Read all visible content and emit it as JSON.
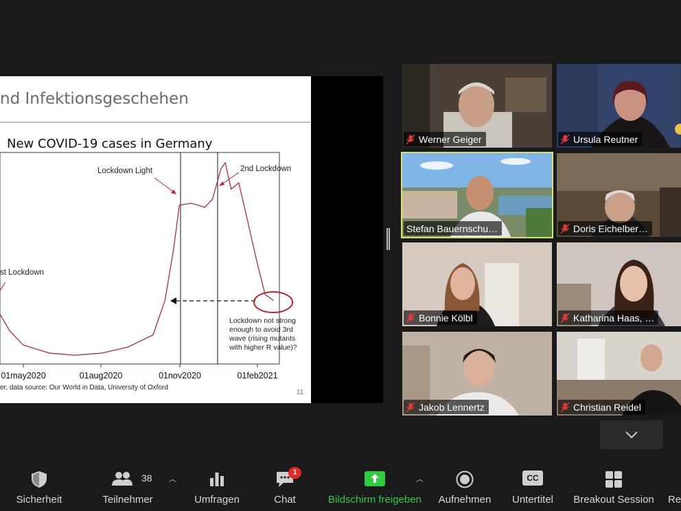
{
  "slide": {
    "title": "nd Infektionsgeschehen",
    "chart_title": "New COVID-19 cases in Germany",
    "annotations": {
      "lockdown_light": "Lockdown Light",
      "second_lockdown": "2nd Lockdown",
      "first_lockdown": "st Lockdown",
      "note_lines": [
        "Lockdown not strong",
        "enough to avoid 3rd",
        "wave (rising mutants",
        "with higher R value)?"
      ]
    },
    "source": "er, data source: Our World in Data, University of Oxford",
    "page_number": "11"
  },
  "chart_data": {
    "type": "line",
    "title": "New COVID-19 cases in Germany",
    "xlabel": "",
    "ylabel": "",
    "x_ticks": [
      "01may2020",
      "01aug2020",
      "01nov2020",
      "01feb2021"
    ],
    "series": [
      {
        "x": [
          "2020-03-15",
          "2020-04-01",
          "2020-04-15",
          "2020-05-01",
          "2020-06-01",
          "2020-07-01",
          "2020-08-01",
          "2020-09-01",
          "2020-10-01",
          "2020-10-15",
          "2020-10-25",
          "2020-11-01",
          "2020-11-15",
          "2020-12-01",
          "2020-12-10",
          "2020-12-20",
          "2020-12-25",
          "2021-01-01",
          "2021-01-10",
          "2021-01-20",
          "2021-02-01",
          "2021-02-10",
          "2021-02-20"
        ],
        "y_relative": [
          0.4,
          0.25,
          0.15,
          0.08,
          0.04,
          0.03,
          0.04,
          0.07,
          0.13,
          0.3,
          0.55,
          0.77,
          0.78,
          0.76,
          0.8,
          0.95,
          0.98,
          0.85,
          0.88,
          0.7,
          0.48,
          0.33,
          0.3
        ]
      }
    ]
  },
  "participants": [
    {
      "name": "Werner Geiger",
      "muted": true
    },
    {
      "name": "Ursula Reutner",
      "muted": true
    },
    {
      "name": "Stefan Bauernschu…",
      "muted": false,
      "active": true
    },
    {
      "name": "Doris Eichelber…",
      "muted": true
    },
    {
      "name": "Bonnie Kölbl",
      "muted": true
    },
    {
      "name": "Katharina Haas, …",
      "muted": true
    },
    {
      "name": "Jakob Lennertz",
      "muted": true
    },
    {
      "name": "Christian Reidel",
      "muted": true
    }
  ],
  "toolbar": {
    "security": "Sicherheit",
    "participants": "Teilnehmer",
    "participants_count": "38",
    "polls": "Umfragen",
    "chat": "Chat",
    "chat_badge": "1",
    "share": "Bildschirm freigeben",
    "record": "Aufnehmen",
    "subtitles": "Untertitel",
    "cc_glyph": "CC",
    "breakout": "Breakout Session",
    "reactions": "Re"
  },
  "colors": {
    "background": "#1a1a1a",
    "share_green": "#2ecc40",
    "active_speaker": "#d9e36a",
    "chart_line": "#b5283e",
    "badge": "#e02828"
  }
}
